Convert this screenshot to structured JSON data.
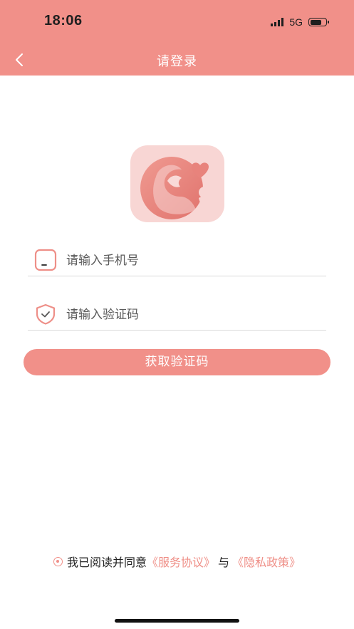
{
  "status_bar": {
    "time": "18:06",
    "network": "5G"
  },
  "header": {
    "title": "请登录"
  },
  "login": {
    "phone_placeholder": "请输入手机号",
    "code_placeholder": "请输入验证码",
    "get_code_label": "获取验证码"
  },
  "agreement": {
    "prefix": "我已阅读并同意",
    "service_link": "《服务协议》",
    "and": "与",
    "privacy_link": "《隐私政策》"
  },
  "colors": {
    "accent": "#f19089",
    "logo_bg": "#f8d6d4",
    "link": "#ef8f87"
  },
  "icons": [
    "back-icon",
    "phone-icon",
    "shield-check-icon",
    "radio-icon",
    "app-logo"
  ]
}
